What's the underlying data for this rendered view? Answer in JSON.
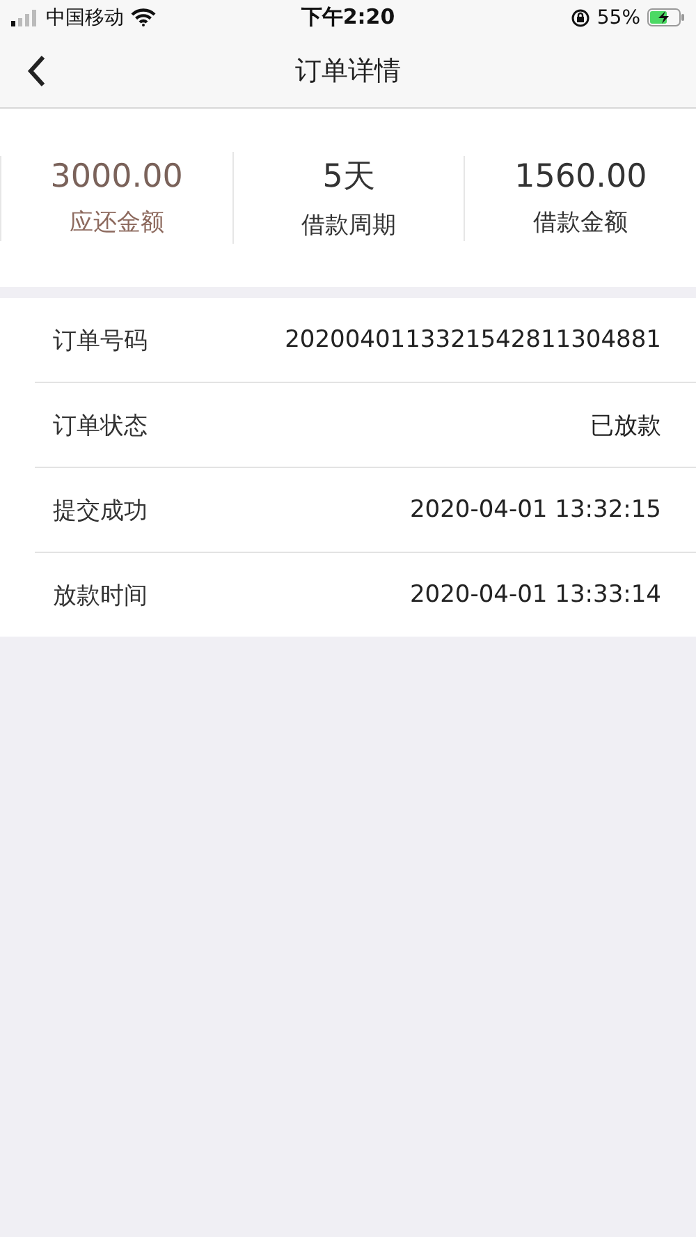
{
  "status_bar": {
    "carrier": "中国移动",
    "time": "下午2:20",
    "battery": "55%"
  },
  "nav": {
    "title": "订单详情"
  },
  "summary": [
    {
      "value": "3000.00",
      "label": "应还金额",
      "kind": "highlight"
    },
    {
      "value": "5天",
      "label": "借款周期",
      "kind": "plain"
    },
    {
      "value": "1560.00",
      "label": "借款金额",
      "kind": "plain"
    }
  ],
  "details": [
    {
      "label": "订单号码",
      "value": "2020040113321542811304881"
    },
    {
      "label": "订单状态",
      "value": "已放款"
    },
    {
      "label": "提交成功",
      "value": "2020-04-01 13:32:15"
    },
    {
      "label": "放款时间",
      "value": "2020-04-01 13:33:14"
    }
  ]
}
